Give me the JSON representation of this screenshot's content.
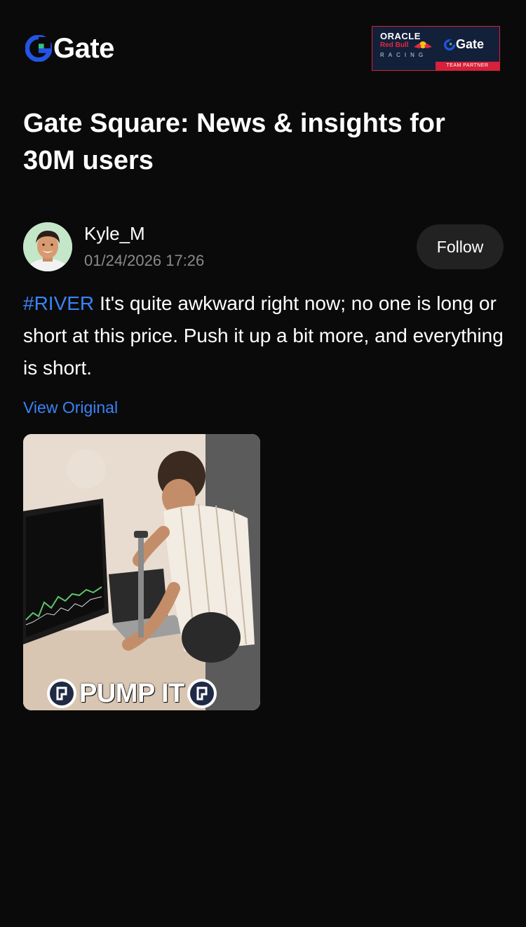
{
  "header": {
    "brand_name": "Gate",
    "brand_color": "#2354e6",
    "partner_badge": {
      "line1": "ORACLE",
      "line2": "Red Bull",
      "line3": "RACING",
      "partner_name": "Gate",
      "strip": "TEAM PARTNER"
    }
  },
  "headline": "Gate Square: News & insights for 30M users",
  "post": {
    "author": "Kyle_M",
    "timestamp": "01/24/2026 17:26",
    "follow_label": "Follow",
    "hashtag": "#RIVER",
    "text": "It's quite awkward right now; no one is long or short at this price. Push it up a bit more, and everything is short.",
    "view_original": "View Original",
    "media": {
      "caption": "PUMP IT"
    }
  },
  "colors": {
    "background": "#0a0a0a",
    "link": "#3b82f6",
    "muted": "#8a8a8a",
    "button": "#222222"
  }
}
